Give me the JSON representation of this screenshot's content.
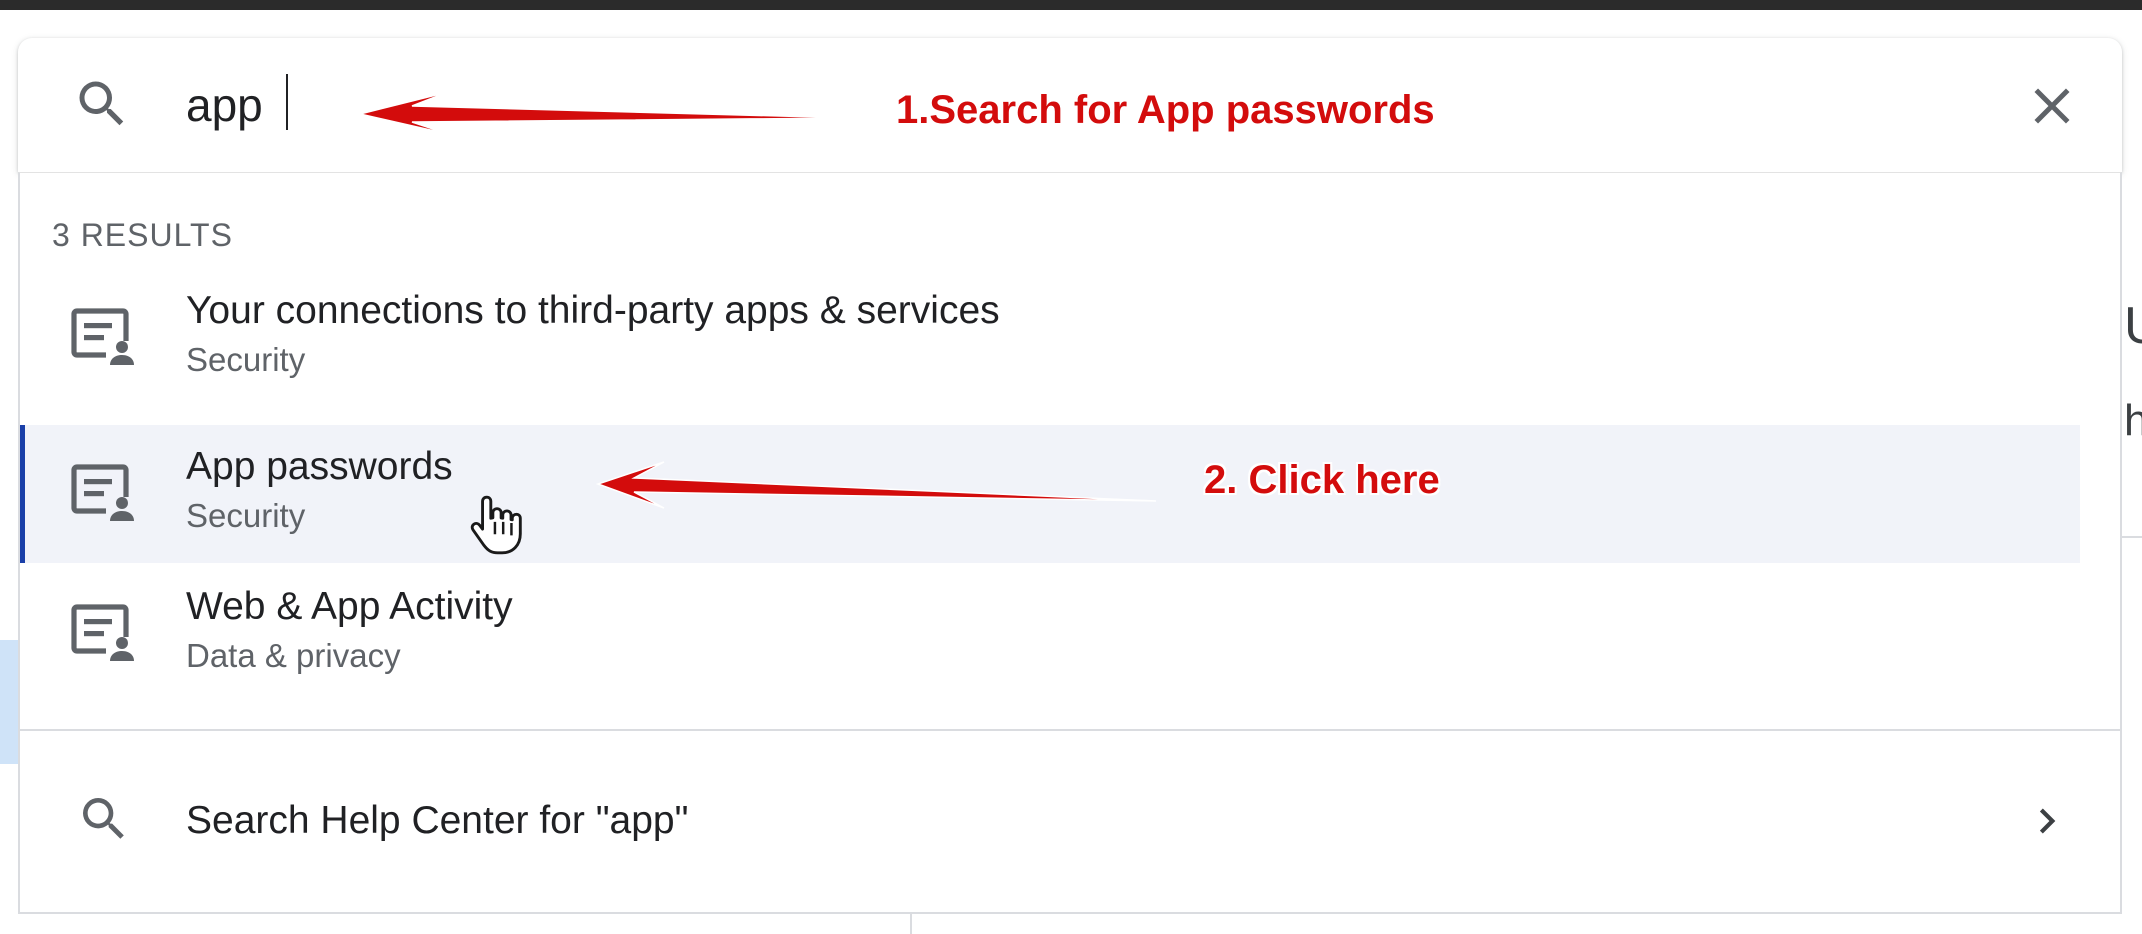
{
  "search": {
    "value": "app",
    "clear_label": "Clear search"
  },
  "results": {
    "count_label": "3 RESULTS",
    "items": [
      {
        "title": "Your connections to third-party apps & services",
        "subtitle": "Security",
        "icon": "settings-account-icon"
      },
      {
        "title": "App passwords",
        "subtitle": "Security",
        "icon": "settings-account-icon",
        "selected": true
      },
      {
        "title": "Web & App Activity",
        "subtitle": "Data & privacy",
        "icon": "settings-account-icon"
      }
    ],
    "help": {
      "label": "Search Help Center for \"app\"",
      "icon": "search-icon"
    }
  },
  "background": {
    "partial_text_1": "U",
    "partial_text_2": "h"
  },
  "annotations": {
    "step1": "1.Search for App passwords",
    "step2": "2. Click here"
  },
  "colors": {
    "annotation_red": "#d30c0c",
    "selected_bar": "#1a3fa8",
    "selected_bg": "#f1f3f9"
  }
}
